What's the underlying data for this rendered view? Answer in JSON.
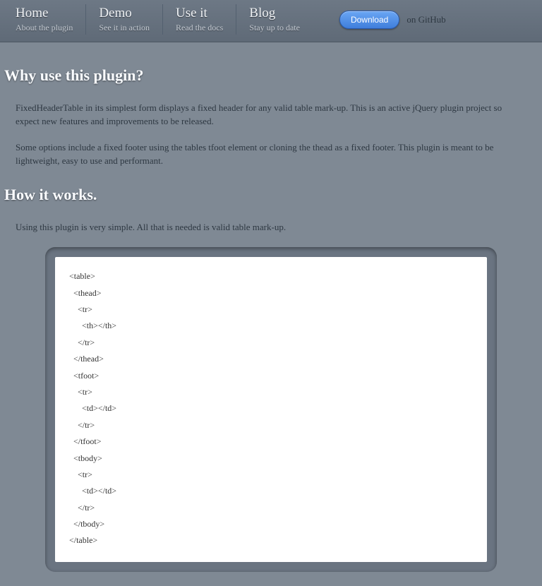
{
  "nav": {
    "items": [
      {
        "title": "Home",
        "sub": "About the plugin"
      },
      {
        "title": "Demo",
        "sub": "See it in action"
      },
      {
        "title": "Use it",
        "sub": "Read the docs"
      },
      {
        "title": "Blog",
        "sub": "Stay up to date"
      }
    ],
    "download_label": "Download",
    "github_text": "on GitHub"
  },
  "sections": {
    "why_heading": "Why use this plugin?",
    "why_p1": "FixedHeaderTable in its simplest form displays a fixed header for any valid table mark-up. This is an active jQuery plugin project so expect new features and improvements to be released.",
    "why_p2": "Some options include a fixed footer using the tables tfoot element or cloning the thead as a fixed footer. This plugin is meant to be lightweight, easy to use and performant.",
    "how_heading": "How it works.",
    "how_p1": "Using this plugin is very simple. All that is needed is valid table mark-up."
  },
  "code": {
    "lines": [
      "<table>",
      "  <thead>",
      "    <tr>",
      "      <th></th>",
      "    </tr>",
      "  </thead>",
      "  <tfoot>",
      "    <tr>",
      "      <td></td>",
      "    </tr>",
      "  </tfoot>",
      "  <tbody>",
      "    <tr>",
      "      <td></td>",
      "    </tr>",
      "  </tbody>",
      "</table>"
    ]
  }
}
